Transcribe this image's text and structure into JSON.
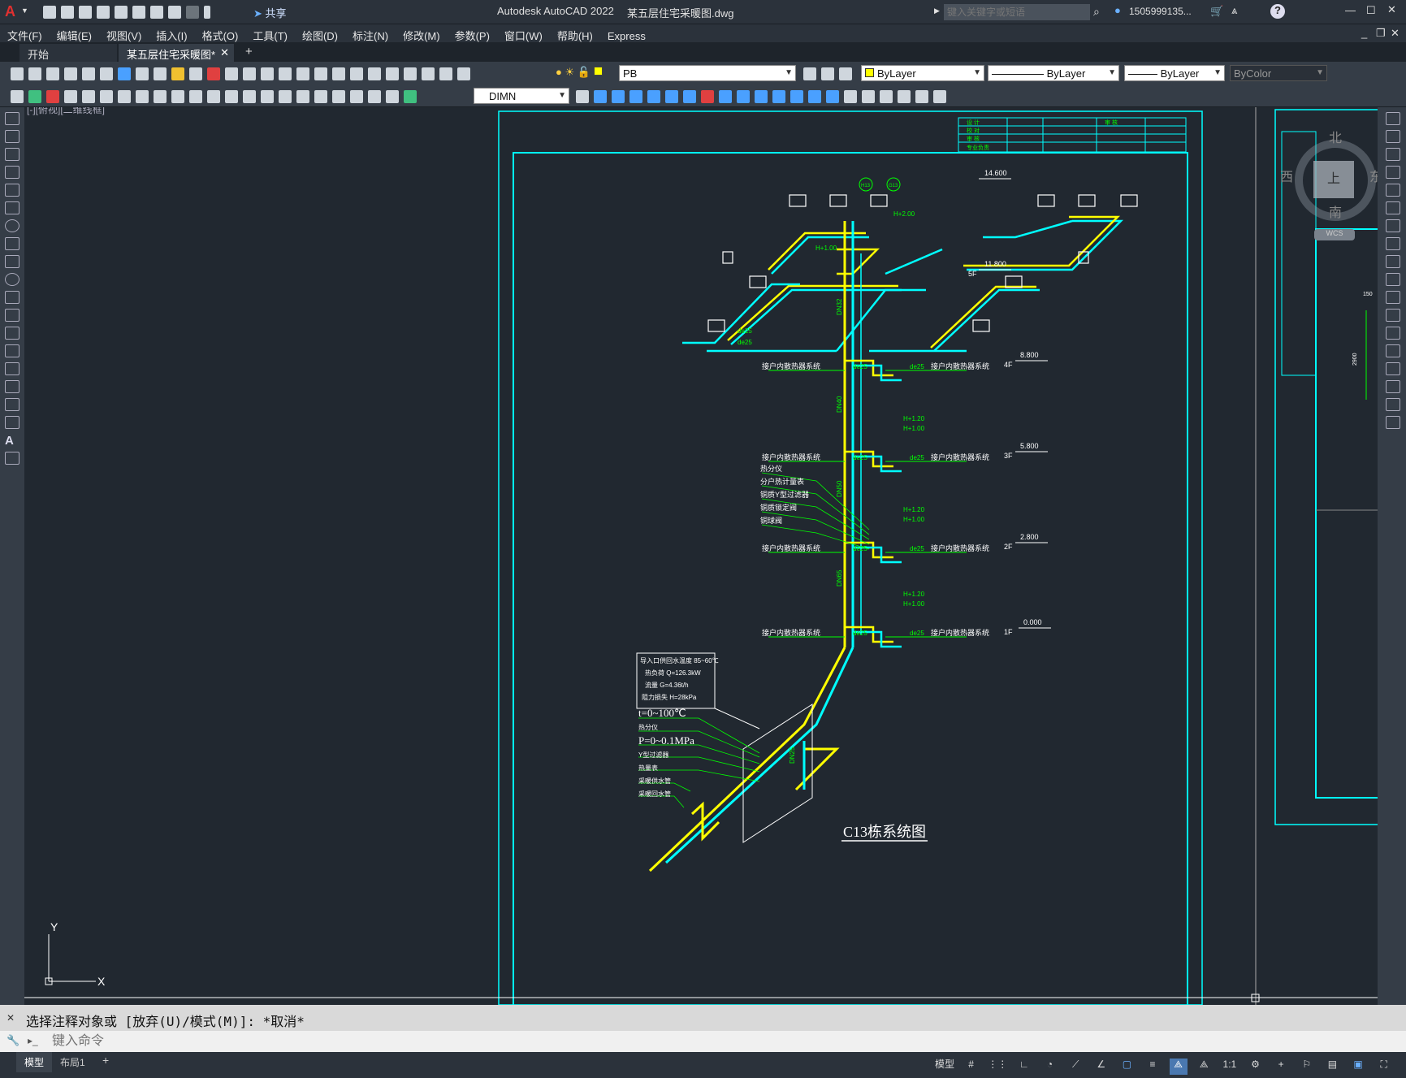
{
  "app": {
    "title": "Autodesk AutoCAD 2022",
    "document": "某五层住宅采暖图.dwg",
    "share_label": "共享",
    "search_placeholder": "键入关键字或短语",
    "user": "1505999135...",
    "help": "?"
  },
  "menu": [
    "文件(F)",
    "编辑(E)",
    "视图(V)",
    "插入(I)",
    "格式(O)",
    "工具(T)",
    "绘图(D)",
    "标注(N)",
    "修改(M)",
    "参数(P)",
    "窗口(W)",
    "帮助(H)",
    "Express"
  ],
  "tabs": {
    "start": "开始",
    "active": "某五层住宅采暖图*",
    "close": "✕",
    "add": "+"
  },
  "toolbar": {
    "layer": "PB",
    "color": "ByLayer",
    "linetype": "ByLayer",
    "lineweight": "ByLayer",
    "plotstyle": "ByColor",
    "dimstyle": "DIMN"
  },
  "viewport_label": "[-][俯视][二维线框]",
  "viewcube": {
    "north": "北",
    "south": "南",
    "west": "西",
    "east": "东",
    "top": "上",
    "wcs": "WCS"
  },
  "ucs": {
    "x": "X",
    "y": "Y"
  },
  "drawing": {
    "title": "C13栋系统图",
    "title_block": [
      [
        "设 计",
        "",
        "审 核",
        ""
      ],
      [
        "校 对",
        "",
        "",
        ""
      ],
      [
        "审 核",
        "",
        "",
        ""
      ],
      [
        "专业负责",
        "",
        "",
        ""
      ]
    ],
    "elevations": [
      {
        "label": "14.600"
      },
      {
        "label": "11.800",
        "floor": "5F"
      },
      {
        "label": "8.800",
        "floor": "4F"
      },
      {
        "label": "5.800",
        "floor": "3F"
      },
      {
        "label": "2.800",
        "floor": "2F"
      },
      {
        "label": "0.000",
        "floor": "1F"
      }
    ],
    "floor_tag": "接户内散热器系统",
    "pipe_labels": [
      "de25",
      "DN32",
      "DN40",
      "DN50",
      "DN65",
      "DN25"
    ],
    "heights": [
      "H+2.00",
      "H+1.00",
      "H+1.20",
      "H+1.00",
      "H+1.20",
      "H+1.00",
      "H+1.20",
      "H+1.00"
    ],
    "inlet_note": [
      "导入口供回水温度 85~60℃",
      "热负荷 Q=126.3kW",
      "流量 G=4.36t/h",
      "阻力损失 H=28kPa"
    ],
    "legend": [
      "t=0~100℃",
      "热分仪",
      "P=0~0.1MPa",
      "Y型过滤器",
      "热量表",
      "采暖供水管",
      "采暖回水管"
    ],
    "valve_legend": [
      "热分仪",
      "分户热计量表",
      "铜质Y型过滤器",
      "铜质锁定阀",
      "铜球阀"
    ],
    "bubble_a": "H13",
    "bubble_b": "G13",
    "side_dims": [
      "150",
      "2900"
    ]
  },
  "command": {
    "history": "选择注释对象或 [放弃(U)/模式(M)]: *取消*",
    "placeholder": "键入命令"
  },
  "layout_tabs": [
    "模型",
    "布局1",
    "+"
  ],
  "status": {
    "model": "模型",
    "scale": "1:1"
  }
}
